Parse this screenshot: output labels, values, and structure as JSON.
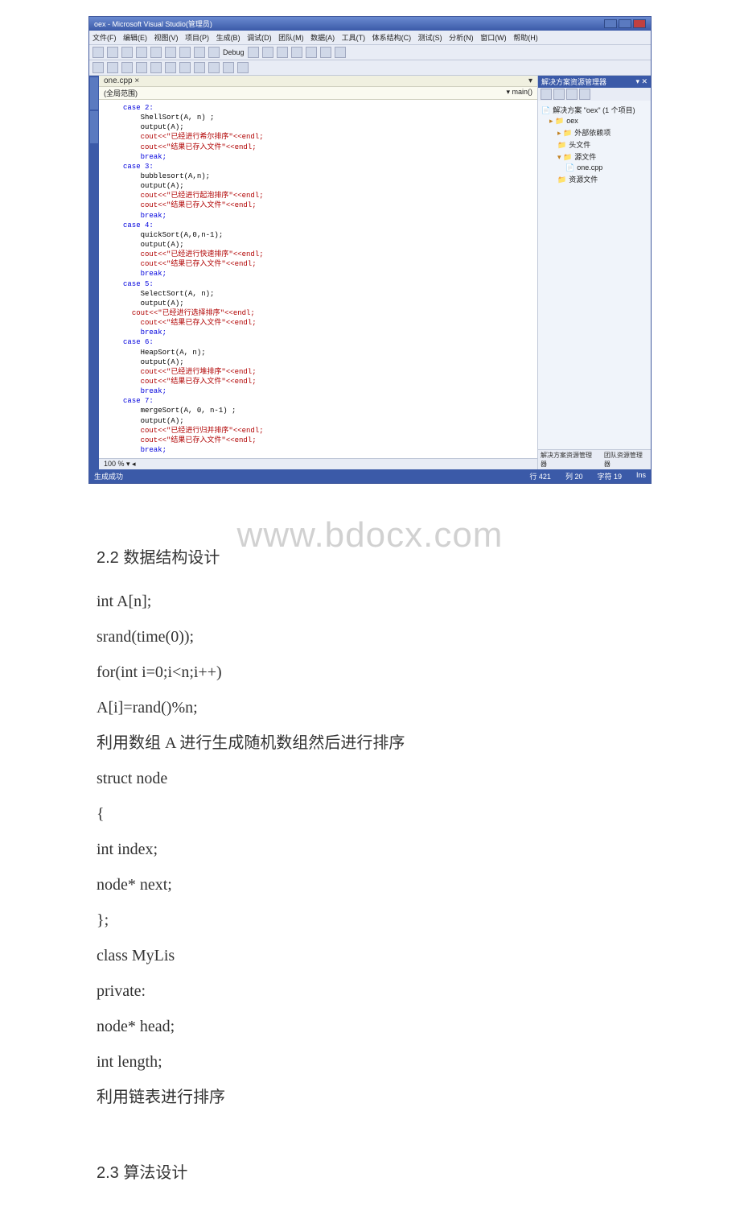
{
  "ide": {
    "title": "oex - Microsoft Visual Studio(管理员)",
    "menu": [
      "文件(F)",
      "编辑(E)",
      "视图(V)",
      "项目(P)",
      "生成(B)",
      "调试(D)",
      "团队(M)",
      "数据(A)",
      "工具(T)",
      "体系结构(C)",
      "测试(S)",
      "分析(N)",
      "窗口(W)",
      "帮助(H)"
    ],
    "toolbar_config": "Debug",
    "tab_label": "one.cpp ×",
    "scope_left": "(全局范围)",
    "scope_right": "▾ main()",
    "code": {
      "case2": "case 2:",
      "l2a": "ShellSort(A, n) ;",
      "l2b": "output(A);",
      "l2c": "cout<<\"已经进行希尔排序\"<<endl;",
      "l2d": "cout<<\"结果已存入文件\"<<endl;",
      "l2e": "break;",
      "case3": "case 3:",
      "l3a": "bubblesort(A,n);",
      "l3b": "output(A);",
      "l3c": "cout<<\"已经进行起泡排序\"<<endl;",
      "l3d": "cout<<\"结果已存入文件\"<<endl;",
      "l3e": "break;",
      "case4": "case 4:",
      "l4a": "quickSort(A,0,n-1);",
      "l4b": "output(A);",
      "l4c": "cout<<\"已经进行快速排序\"<<endl;",
      "l4d": "cout<<\"结果已存入文件\"<<endl;",
      "l4e": "break;",
      "case5": "case 5:",
      "l5a": "SelectSort(A, n);",
      "l5b": "output(A);",
      "l5c": "cout<<\"已经进行选择排序\"<<endl;",
      "l5d": "cout<<\"结果已存入文件\"<<endl;",
      "l5e": "break;",
      "case6": "case 6:",
      "l6a": "HeapSort(A, n);",
      "l6b": "output(A);",
      "l6c": "cout<<\"已经进行堆排序\"<<endl;",
      "l6d": "cout<<\"结果已存入文件\"<<endl;",
      "l6e": "break;",
      "case7": "case 7:",
      "l7a": "mergeSort(A, 0, n-1) ;",
      "l7b": "output(A);",
      "l7c": "cout<<\"已经进行归并排序\"<<endl;",
      "l7d": "cout<<\"结果已存入文件\"<<endl;",
      "l7e": "break;"
    },
    "editor_status": "100 %  ▾ ◂",
    "solution_panel_title": "解决方案资源管理器",
    "solution_root": "解决方案 \"oex\" (1 个项目)",
    "proj": "oex",
    "ext_dep": "外部依赖项",
    "headers": "头文件",
    "sources": "源文件",
    "source_file": "one.cpp",
    "resources": "资源文件",
    "panel_foot_left": "解决方案资源管理器",
    "panel_foot_right": "团队资源管理器",
    "bottom_left": "生成成功",
    "bottom_line": "行 421",
    "bottom_col": "列 20",
    "bottom_ch": "字符 19",
    "bottom_ins": "Ins"
  },
  "doc": {
    "h22": "2.2 数据结构设计",
    "l1": " int A[n];",
    "l2": " srand(time(0));",
    "l3": " for(int i=0;i<n;i++)",
    "l4": " A[i]=rand()%n;",
    "l5": "利用数组 A 进行生成随机数组然后进行排序",
    "l6": "struct node",
    "l7": "{",
    "l8": " int index;",
    "l9": " node* next;",
    "l10": "};",
    "l11": "class MyLis",
    "l12": "private:",
    "l13": " node* head;",
    "l14": " int length;",
    "l15": "利用链表进行排序",
    "h23": "2.3 算法设计"
  },
  "watermark": "www.bdocx.com"
}
